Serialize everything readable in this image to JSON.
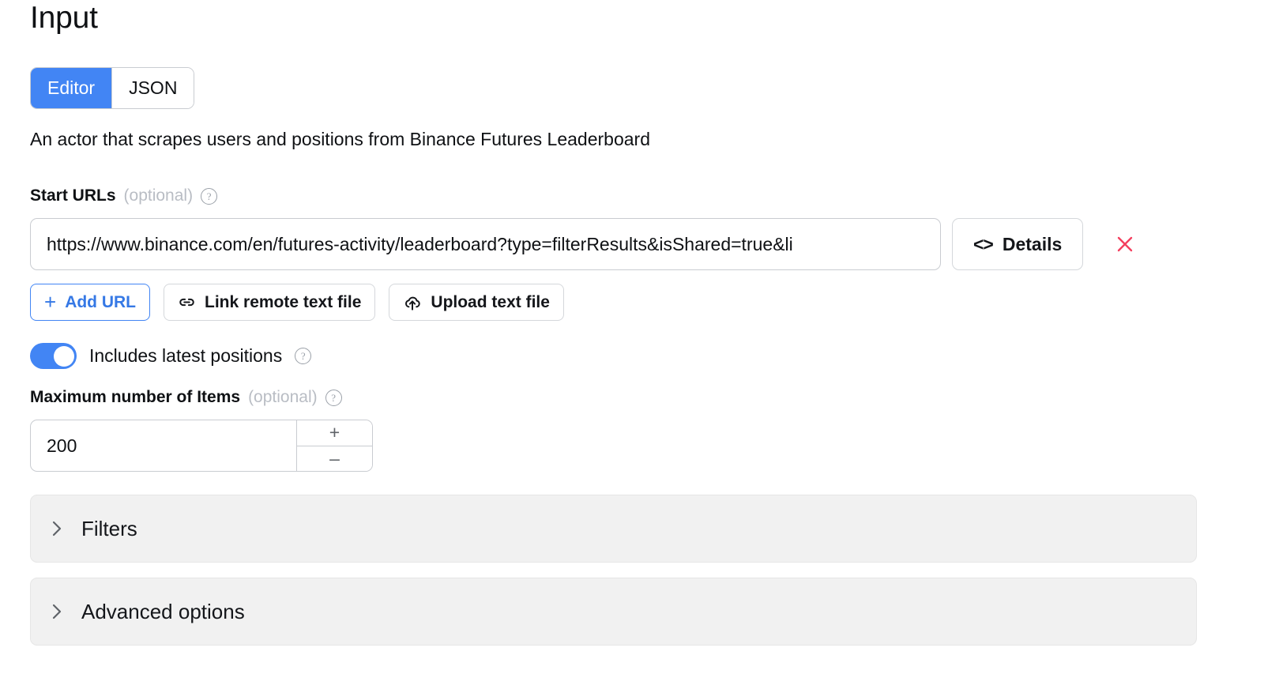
{
  "page": {
    "title": "Input",
    "description": "An actor that scrapes users and positions from Binance Futures Leaderboard"
  },
  "mode_toggle": {
    "editor_label": "Editor",
    "json_label": "JSON",
    "selected": "Editor"
  },
  "start_urls": {
    "label": "Start URLs",
    "optional_text": "(optional)",
    "help_icon": "question-mark-circle-icon",
    "value": "https://www.binance.com/en/futures-activity/leaderboard?type=filterResults&isShared=true&li",
    "details_label": "Details",
    "details_icon": "code-brackets-icon",
    "remove_icon": "close-x-icon",
    "remove_color": "#f43f5e"
  },
  "actions": {
    "add_url_label": "Add URL",
    "add_url_icon": "plus-icon",
    "link_remote_label": "Link remote text file",
    "link_remote_icon": "chain-link-icon",
    "upload_label": "Upload text file",
    "upload_icon": "cloud-upload-icon"
  },
  "includes_latest_positions": {
    "label": "Includes latest positions",
    "enabled": true,
    "help_icon": "question-mark-circle-icon",
    "accent_color": "#4285f4"
  },
  "max_items": {
    "label": "Maximum number of Items",
    "optional_text": "(optional)",
    "help_icon": "question-mark-circle-icon",
    "value": "200",
    "increment_label": "+",
    "decrement_label": "–"
  },
  "sections": [
    {
      "title": "Filters",
      "expanded": false,
      "icon": "chevron-right-icon"
    },
    {
      "title": "Advanced options",
      "expanded": false,
      "icon": "chevron-right-icon"
    }
  ]
}
